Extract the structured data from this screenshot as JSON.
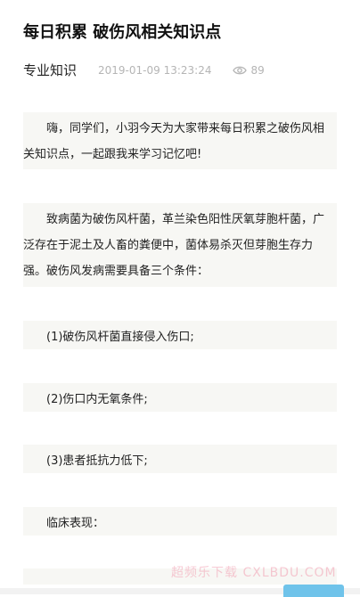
{
  "article": {
    "title": "每日积累 破伤风相关知识点",
    "category": "专业知识",
    "date": "2019-01-09 13:23:24",
    "views": "89"
  },
  "content": {
    "p1": "嗨，同学们，小羽今天为大家带来每日积累之破伤风相关知识点，一起跟我来学习记忆吧!",
    "p2": "致病菌为破伤风杆菌，革兰染色阳性厌氧芽胞杆菌，广泛存在于泥土及人畜的粪便中，菌体易杀灭但芽胞生存力强。破伤风发病需要具备三个条件：",
    "i1": "(1)破伤风杆菌直接侵入伤口;",
    "i2": "(2)伤口内无氧条件;",
    "i3": "(3)患者抵抗力低下;",
    "i4": "临床表现："
  },
  "watermark": "超频乐下载 CXLBDU.COM",
  "icons": {
    "views": "eye-icon"
  }
}
